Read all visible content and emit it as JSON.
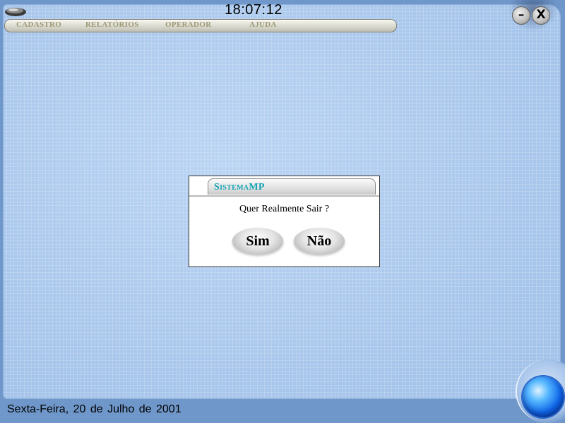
{
  "clock": "18:07:12",
  "menu": {
    "items": [
      {
        "label": "CADASTRO"
      },
      {
        "label": "RELATÓRIOS"
      },
      {
        "label": "OPERADOR"
      },
      {
        "label": "AJUDA"
      }
    ]
  },
  "window_controls": {
    "minimize_label": "–",
    "close_label": "X"
  },
  "dialog": {
    "title": "SistemaMP",
    "message": "Quer Realmente Sair ?",
    "yes_label": "Sim",
    "no_label": "Não"
  },
  "status": {
    "date": "Sexta-Feira, 20 de Julho de 2001"
  },
  "colors": {
    "panel": "#aecbee",
    "dialog_title": "#14a4b4",
    "menu_text": "#9e9a74",
    "orb": "#0d62e6"
  },
  "icons": [
    "app-logo-icon",
    "minimize-icon",
    "close-icon",
    "orb-icon"
  ]
}
